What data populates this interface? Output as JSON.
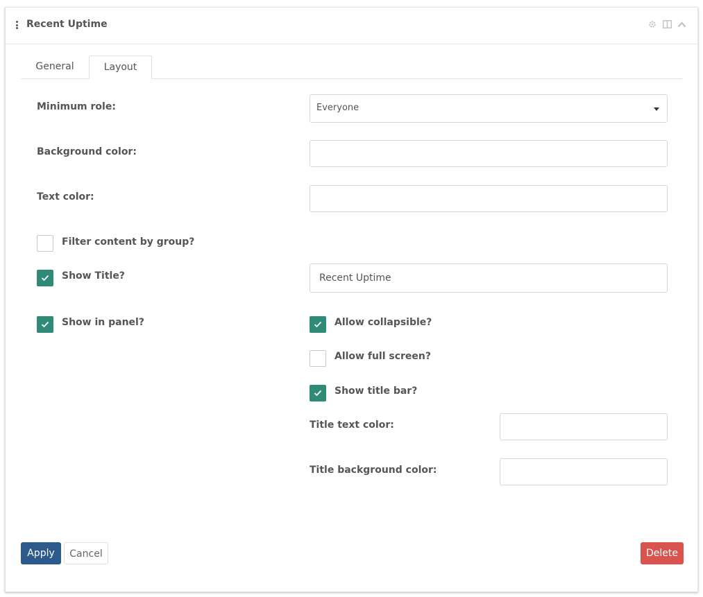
{
  "panel": {
    "title": "Recent Uptime",
    "icons": [
      "gear-icon",
      "columns-icon",
      "chevron-up-icon"
    ]
  },
  "tabs": [
    {
      "label": "General",
      "active": false
    },
    {
      "label": "Layout",
      "active": true
    }
  ],
  "form": {
    "minimum_role": {
      "label": "Minimum role:",
      "value": "Everyone"
    },
    "background_color": {
      "label": "Background color:",
      "value": ""
    },
    "text_color": {
      "label": "Text color:",
      "value": ""
    },
    "filter_by_group": {
      "label": "Filter content by group?",
      "checked": false
    },
    "show_title": {
      "label": "Show Title?",
      "checked": true,
      "title_value": "Recent Uptime"
    },
    "show_in_panel": {
      "label": "Show in panel?",
      "checked": true
    },
    "allow_collapsible": {
      "label": "Allow collapsible?",
      "checked": true
    },
    "allow_full_screen": {
      "label": "Allow full screen?",
      "checked": false
    },
    "show_title_bar": {
      "label": "Show title bar?",
      "checked": true
    },
    "title_text_color": {
      "label": "Title text color:",
      "value": ""
    },
    "title_background_color": {
      "label": "Title background color:",
      "value": ""
    }
  },
  "buttons": {
    "apply": "Apply",
    "cancel": "Cancel",
    "delete": "Delete"
  },
  "colors": {
    "check_accent": "#2f8a78",
    "apply_bg": "#2d5a8c",
    "delete_bg": "#d9534f"
  }
}
